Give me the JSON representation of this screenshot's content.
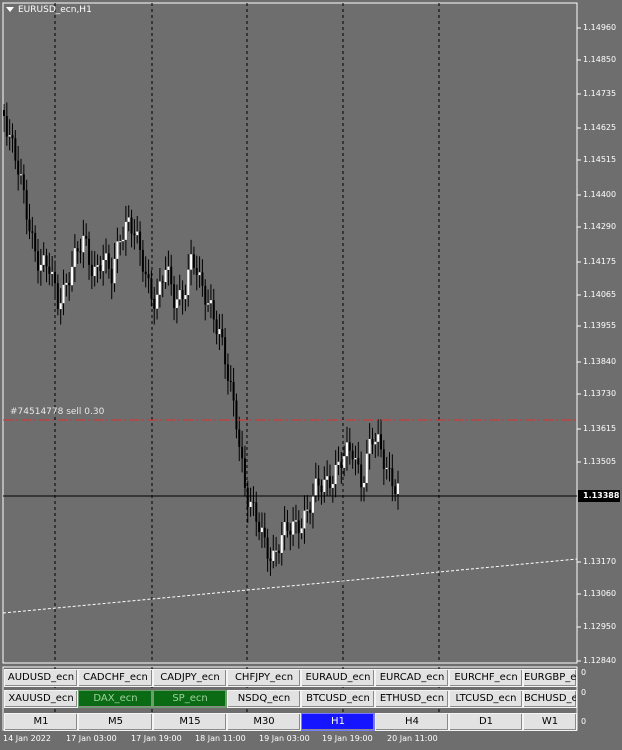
{
  "window": {
    "title": "EURUSD_ecn,H1"
  },
  "price_axis": {
    "labels": [
      "1.14960",
      "1.14850",
      "1.14735",
      "1.14625",
      "1.14515",
      "1.14400",
      "1.14290",
      "1.14175",
      "1.14065",
      "1.13955",
      "1.13840",
      "1.13730",
      "1.13615",
      "1.13505",
      "1.13388",
      "1.13170",
      "1.13060",
      "1.12950",
      "1.12840"
    ],
    "current_price": "1.13388"
  },
  "time_axis": {
    "labels": [
      "14 Jan 2022",
      "17 Jan 03:00",
      "17 Jan 19:00",
      "18 Jan 11:00",
      "19 Jan 03:00",
      "19 Jan 19:00",
      "20 Jan 11:00"
    ]
  },
  "order": {
    "label": "#74514778 sell 0.30",
    "price": 1.13635
  },
  "colors": {
    "background": "#6e6e6e",
    "bar": "#ffffff",
    "order_line": "#e03030",
    "active_timeframe": "#1515ff",
    "active_symbol": "#0a6b14"
  },
  "symbols_row1": [
    "AUDUSD_ecn",
    "CADCHF_ecn",
    "CADJPY_ecn",
    "CHFJPY_ecn",
    "EURAUD_ecn",
    "EURCAD_ecn",
    "EURCHF_ecn",
    "EURGBP_ecn"
  ],
  "symbols_row2": [
    "XAUUSD_ecn",
    "DAX_ecn",
    "SP_ecn",
    "NSDQ_ecn",
    "BTCUSD_ecn",
    "ETHUSD_ecn",
    "LTCUSD_ecn",
    "BCHUSD_ecn"
  ],
  "active_symbols": [
    "DAX_ecn",
    "SP_ecn"
  ],
  "timeframes": [
    "M1",
    "M5",
    "M15",
    "M30",
    "H1",
    "H4",
    "D1",
    "W1"
  ],
  "active_timeframe": "H1",
  "subwindow_labels": [
    "0",
    "0",
    "0"
  ],
  "chart_data": {
    "type": "bar",
    "symbol": "EURUSD_ecn",
    "timeframe": "H1",
    "ylim": [
      1.1284,
      1.1507
    ],
    "ohlc_close_path": [
      1.1467,
      1.1455,
      1.144,
      1.142,
      1.141,
      1.1395,
      1.1405,
      1.141,
      1.142,
      1.143,
      1.1425,
      1.142,
      1.141,
      1.1405,
      1.141,
      1.1405,
      1.14,
      1.1395,
      1.139,
      1.1385,
      1.138,
      1.137,
      1.136,
      1.1345,
      1.133,
      1.1315,
      1.1305,
      1.13,
      1.131,
      1.1315,
      1.132,
      1.1325,
      1.1335,
      1.1345,
      1.135,
      1.1355,
      1.136,
      1.1355,
      1.135,
      1.1345,
      1.134,
      1.136,
      1.1358,
      1.1348,
      1.1339
    ],
    "current_price": 1.13388,
    "order_line_price": 1.13635,
    "trendline": [
      [
        0,
        1.13
      ],
      [
        1,
        1.1318
      ]
    ]
  }
}
